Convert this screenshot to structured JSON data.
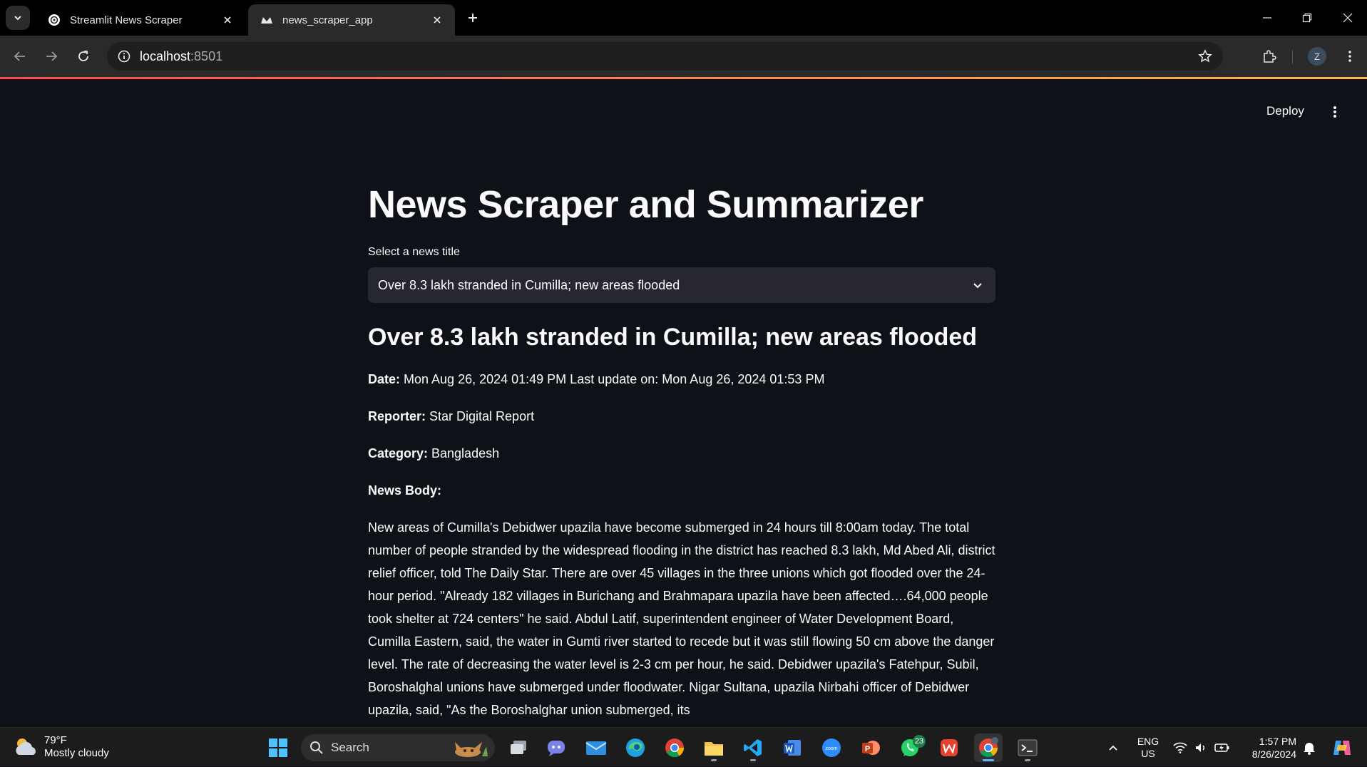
{
  "browser": {
    "tabs": [
      {
        "title": "Streamlit News Scraper",
        "active": false
      },
      {
        "title": "news_scraper_app",
        "active": true
      }
    ],
    "url_host": "localhost",
    "url_port": ":8501",
    "profile_initial": "Z"
  },
  "app": {
    "deploy_label": "Deploy",
    "title": "News Scraper and Summarizer",
    "select_label": "Select a news title",
    "selected_title": "Over 8.3 lakh stranded in Cumilla; new areas flooded",
    "article": {
      "heading": "Over 8.3 lakh stranded in Cumilla; new areas flooded",
      "date_label": "Date:",
      "date_value": " Mon Aug 26, 2024 01:49 PM Last update on: Mon Aug 26, 2024 01:53 PM",
      "reporter_label": "Reporter:",
      "reporter_value": " Star Digital Report",
      "category_label": "Category:",
      "category_value": " Bangladesh",
      "body_label": "News Body:",
      "body": "New areas of Cumilla's Debidwer upazila have become submerged in 24 hours till 8:00am today. The total number of people stranded by the widespread flooding in the district has reached 8.3 lakh, Md Abed Ali, district relief officer, told The Daily Star. There are over 45 villages in the three unions which got flooded over the 24-hour period. \"Already 182 villages in Burichang and Brahmapara upazila have been affected….64,000 people took shelter at 724 centers\" he said. Abdul Latif, superintendent engineer of Water Development Board, Cumilla Eastern, said, the water in Gumti river started to recede but it was still flowing 50 cm above the danger level. The rate of decreasing the water level is 2-3 cm per hour, he said. Debidwer upazila's Fatehpur, Subil, Boroshalghal unions have submerged under floodwater. Nigar Sultana, upazila Nirbahi officer of Debidwer upazila, said, \"As the Boroshalghar union submerged, its"
    }
  },
  "taskbar": {
    "weather_temp": "79°F",
    "weather_desc": "Mostly cloudy",
    "search_label": "Search",
    "whatsapp_badge": "23",
    "lang_primary": "ENG",
    "lang_secondary": "US",
    "time": "1:57 PM",
    "date": "8/26/2024"
  },
  "colors": {
    "app_bg": "#0e1117",
    "select_bg": "#262730",
    "accent_gradient_start": "#ff4b4b",
    "accent_gradient_end": "#fdb94b",
    "browser_toolbar": "#2a2a2a"
  }
}
